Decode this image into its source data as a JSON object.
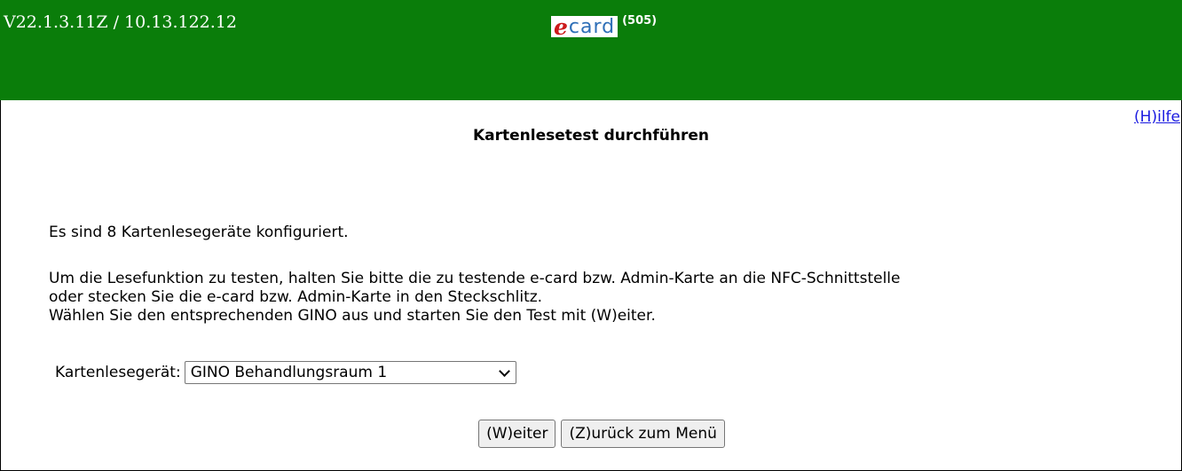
{
  "header": {
    "version": "V22.1.3.11Z / 10.13.122.12",
    "logo_e": "e",
    "logo_card": "card",
    "logo_code": "(505)"
  },
  "help_link": "(H)ilfe",
  "page_title": "Kartenlesetest durchführen",
  "body": {
    "line1": "Es sind 8 Kartenlesegeräte konfiguriert.",
    "line2a": "Um die Lesefunktion zu testen, halten Sie bitte die zu testende e-card bzw. Admin-Karte an die NFC-Schnittstelle",
    "line2b": "oder stecken Sie die e-card bzw. Admin-Karte in den Steckschlitz.",
    "line2c": "Wählen Sie den entsprechenden GINO aus und starten Sie den Test mit (W)eiter."
  },
  "reader_select": {
    "label": "Kartenlesegerät:",
    "selected": "GINO Behandlungsraum 1"
  },
  "buttons": {
    "next": "(W)eiter",
    "back": "(Z)urück zum Menü"
  },
  "colors": {
    "header_bg": "#0a7d0a",
    "link": "#1a1ae0"
  }
}
